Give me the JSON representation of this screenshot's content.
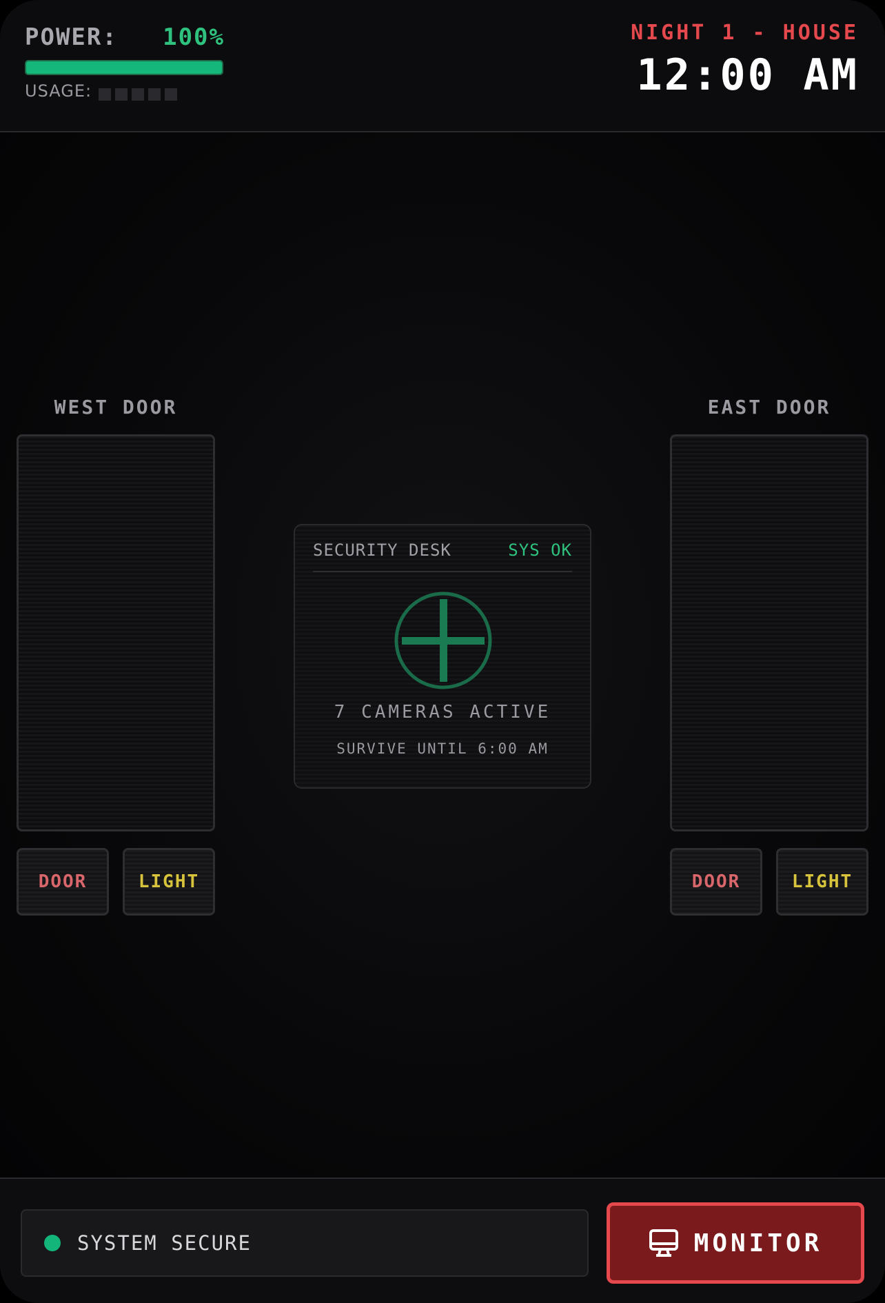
{
  "header": {
    "power_label": "POWER:",
    "power_value": "100%",
    "power_level": 1.0,
    "usage_label": "USAGE:",
    "usage_blocks_total": 5,
    "night_label": "NIGHT 1 - HOUSE",
    "clock": "12:00 AM"
  },
  "west": {
    "title": "WEST DOOR",
    "door_button": "DOOR",
    "light_button": "LIGHT"
  },
  "east": {
    "title": "EAST DOOR",
    "door_button": "DOOR",
    "light_button": "LIGHT"
  },
  "desk": {
    "title": "SECURITY DESK",
    "status": "SYS OK",
    "cameras": "7 CAMERAS ACTIVE",
    "survive": "SURVIVE UNTIL 6:00 AM",
    "icon": "crosshair-icon"
  },
  "footer": {
    "status_text": "SYSTEM SECURE",
    "monitor_label": "MONITOR",
    "monitor_icon": "monitor-icon"
  },
  "colors": {
    "accent_green": "#2ec27e",
    "accent_red": "#e5484d",
    "light_yellow": "#d8c43c",
    "monitor_bg": "#7a1a1c"
  }
}
